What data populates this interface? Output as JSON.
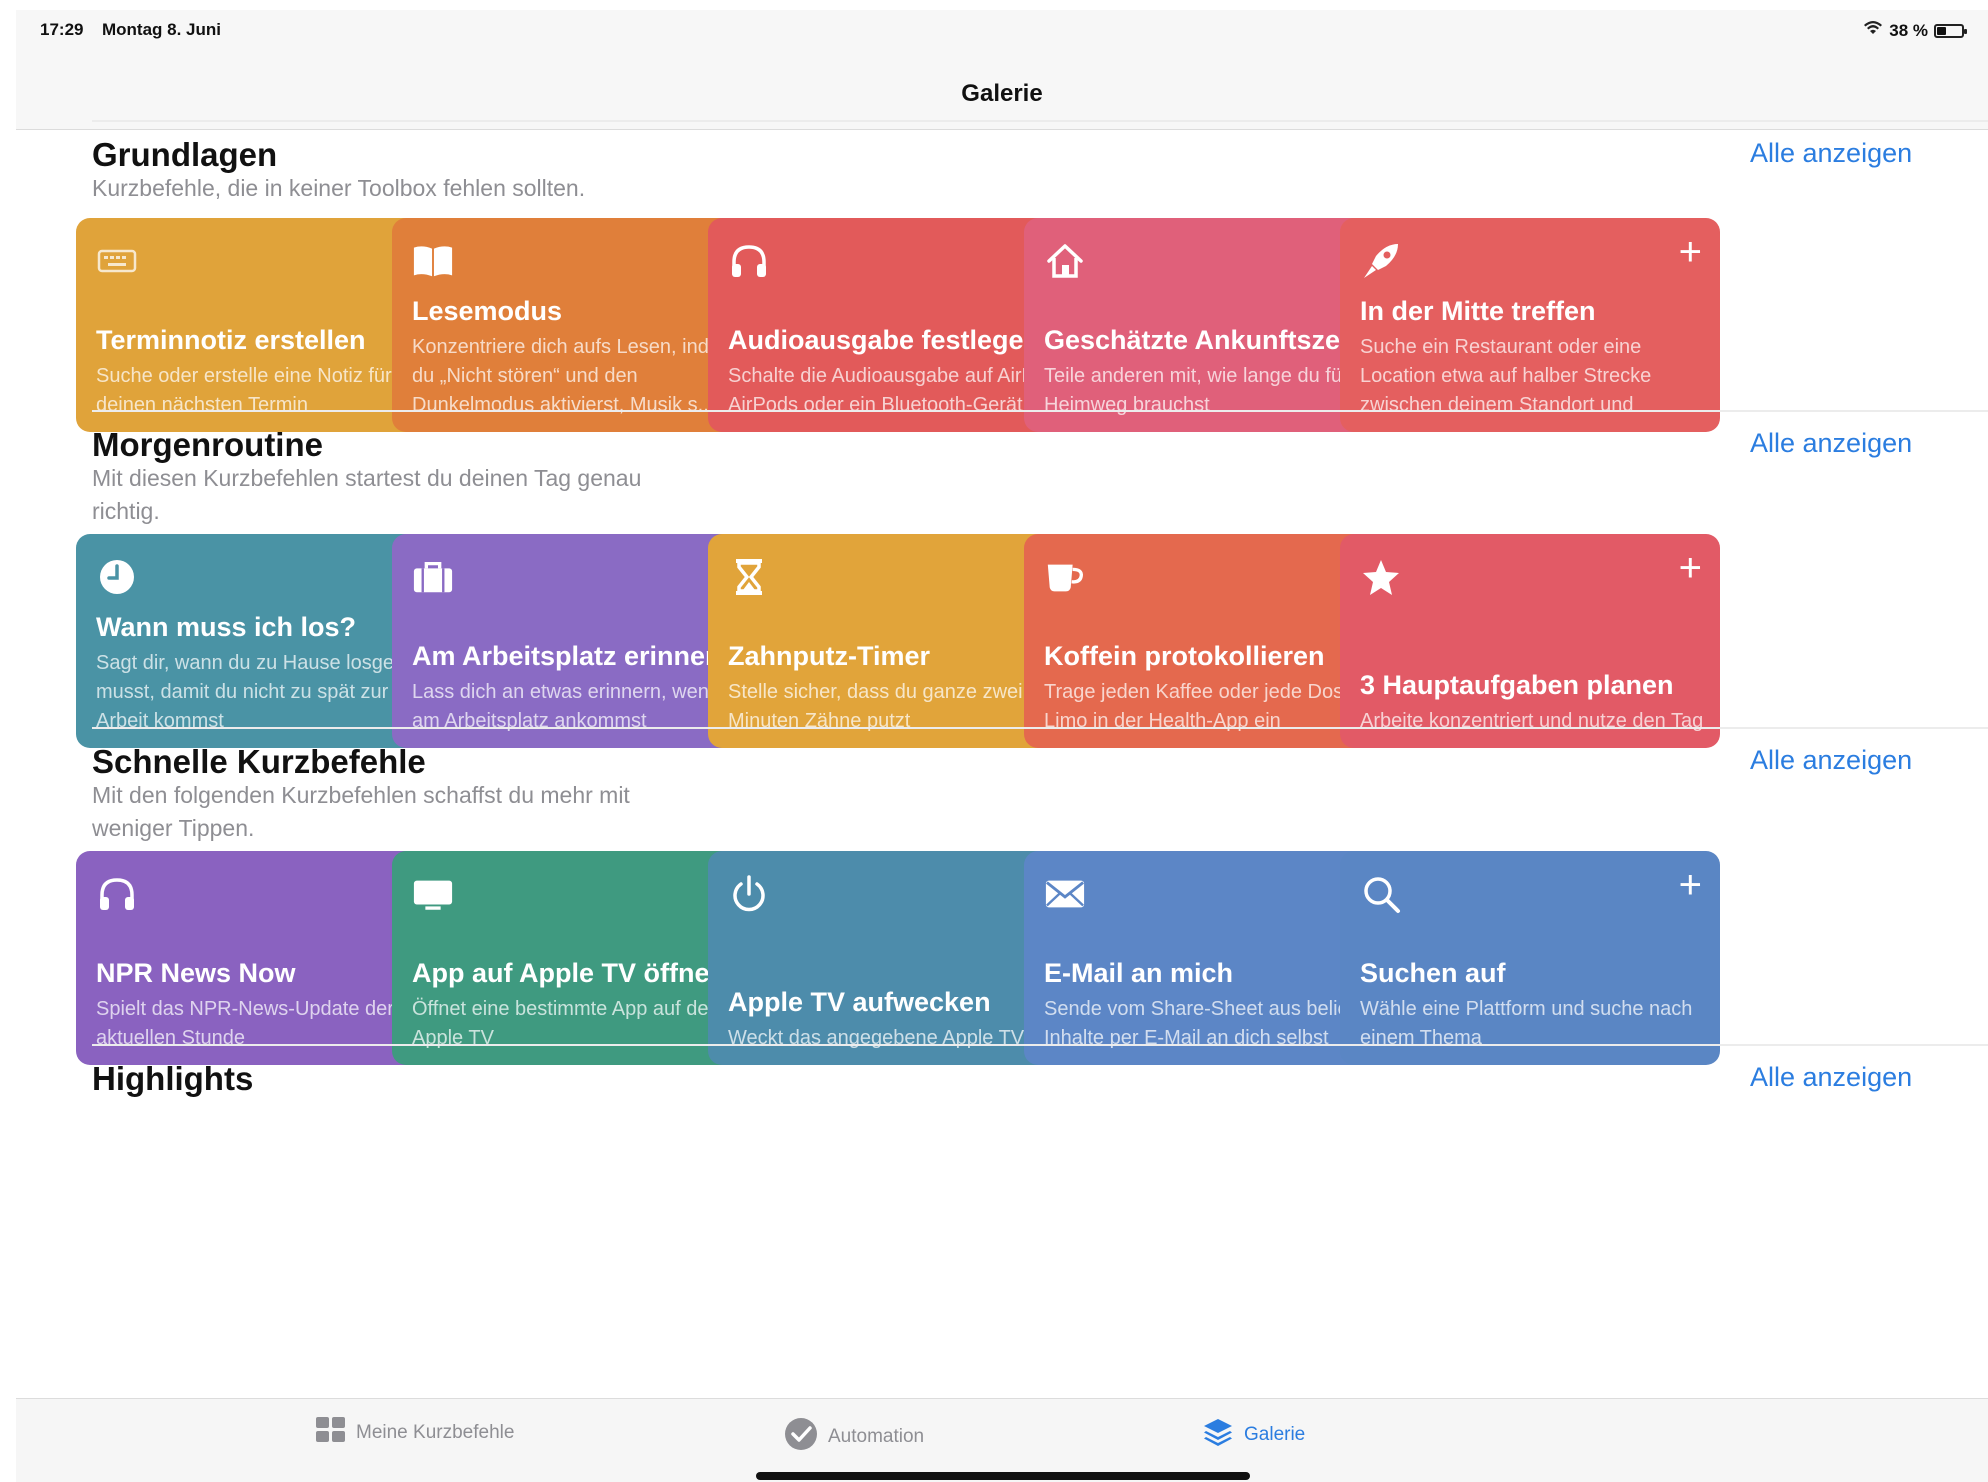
{
  "status_bar": {
    "time": "17:29",
    "date": "Montag 8. Juni",
    "battery": "38 %",
    "battery_level": 0.38
  },
  "nav": {
    "title": "Galerie"
  },
  "colors": {
    "accent": "#2b7de0"
  },
  "sections": [
    {
      "title": "Grundlagen",
      "subtitle": "Kurzbefehle, die in keiner Toolbox fehlen sollten.",
      "see_all": "Alle anzeigen",
      "cards": [
        {
          "title": "Terminnotiz erstellen",
          "desc": "Suche oder erstelle eine Notiz für deinen nächsten Termin",
          "icon": "keyboard-icon",
          "color": "#e0a33a"
        },
        {
          "title": "Lesemodus",
          "desc": "Konzentriere dich aufs Lesen, indem du „Nicht stören“ und den Dunkelmodus aktivierst, Musik s...",
          "icon": "book-icon",
          "color": "#e07f3a"
        },
        {
          "title": "Audioausgabe festlegen",
          "desc": "Schalte die Audioausgabe auf AirPlay, AirPods oder ein Bluetooth-Gerät um",
          "icon": "headphones-icon",
          "color": "#e25a5a"
        },
        {
          "title": "Geschätzte Ankunftszeit",
          "desc": "Teile anderen mit, wie lange du für den Heimweg brauchst",
          "icon": "house-icon",
          "color": "#e0607a"
        },
        {
          "title": "In der Mitte treffen",
          "desc": "Suche ein Restaurant oder eine Location etwa auf halber Strecke zwischen deinem Standort und",
          "icon": "rocket-icon",
          "color": "#e45f5f"
        }
      ]
    },
    {
      "title": "Morgenroutine",
      "subtitle": "Mit diesen Kurzbefehlen startest du deinen Tag genau richtig.",
      "see_all": "Alle anzeigen",
      "cards": [
        {
          "title": "Wann muss ich los?",
          "desc": "Sagt dir, wann du zu Hause losgehen musst, damit du nicht zu spät zur Arbeit kommst",
          "icon": "clock-icon",
          "color": "#4a93a5"
        },
        {
          "title": "Am Arbeitsplatz erinnern",
          "desc": "Lass dich an etwas erinnern, wenn du am Arbeitsplatz ankommst",
          "icon": "briefcase-icon",
          "color": "#8a6bc4"
        },
        {
          "title": "Zahnputz-Timer",
          "desc": "Stelle sicher, dass du ganze zwei Minuten Zähne putzt",
          "icon": "hourglass-icon",
          "color": "#e1a43a"
        },
        {
          "title": "Koffein protokollieren",
          "desc": "Trage jeden Kaffee oder jede Dose Limo in der Health-App ein",
          "icon": "coffee-cup-icon",
          "color": "#e4694e"
        },
        {
          "title": "3 Hauptaufgaben planen",
          "desc": "Arbeite konzentriert und nutze den Tag",
          "icon": "star-icon",
          "color": "#e25a66"
        }
      ]
    },
    {
      "title": "Schnelle Kurzbefehle",
      "subtitle": "Mit den folgenden Kurzbefehlen schaffst du mehr mit weniger Tippen.",
      "see_all": "Alle anzeigen",
      "cards": [
        {
          "title": "NPR News Now",
          "desc": "Spielt das NPR-News-Update der aktuellen Stunde",
          "icon": "headphones-icon",
          "color": "#8a62c0"
        },
        {
          "title": "App auf Apple TV öffnen",
          "desc": "Öffnet eine bestimmte App auf deinem Apple TV",
          "icon": "tv-icon",
          "color": "#3f9a80"
        },
        {
          "title": "Apple TV aufwecken",
          "desc": "Weckt das angegebene Apple TV auf",
          "icon": "power-icon",
          "color": "#4d8cab"
        },
        {
          "title": "E-Mail an mich",
          "desc": "Sende vom Share-Sheet aus beliebige Inhalte per E-Mail an dich selbst",
          "icon": "envelope-icon",
          "color": "#5c86c6"
        },
        {
          "title": "Suchen auf",
          "desc": "Wähle eine Plattform und suche nach einem Thema",
          "icon": "magnifier-icon",
          "color": "#5a86c4"
        }
      ]
    },
    {
      "title": "Highlights",
      "subtitle": "",
      "see_all": "Alle anzeigen",
      "cards": []
    }
  ],
  "tabs": [
    {
      "label": "Meine Kurzbefehle",
      "icon": "grid-icon",
      "active": false
    },
    {
      "label": "Automation",
      "icon": "checkmark-icon",
      "active": false
    },
    {
      "label": "Galerie",
      "icon": "layers-icon",
      "active": true
    }
  ]
}
